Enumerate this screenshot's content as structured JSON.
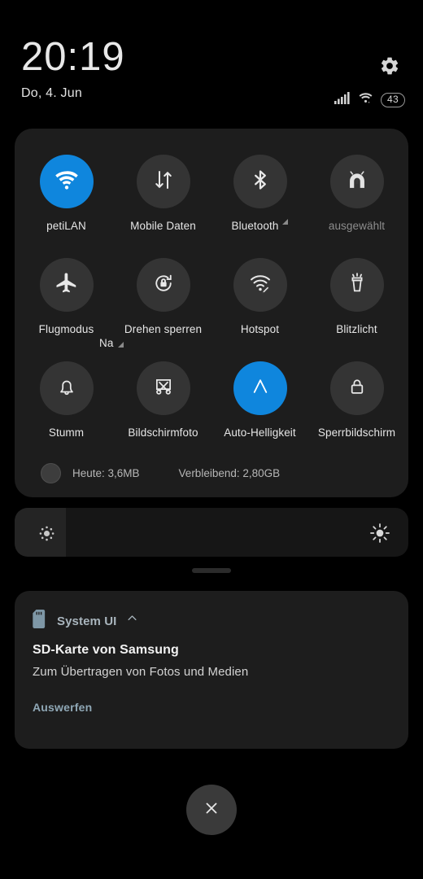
{
  "statusbar": {
    "time": "20:19",
    "date": "Do, 4. Jun",
    "battery_level": "43",
    "settings_icon": "gear-icon",
    "signal_icon": "signal-bars-icon",
    "wifi_icon": "wifi-status-icon"
  },
  "quick_settings": {
    "tiles": [
      {
        "id": "wifi",
        "label": "petiLAN",
        "sublabel": "Na",
        "icon": "wifi-icon",
        "active": true,
        "has_expand_arrow": true,
        "dim": false
      },
      {
        "id": "mobile-data",
        "label": "Mobile Daten",
        "sublabel": "",
        "icon": "data-transfer-icon",
        "active": false,
        "has_expand_arrow": false,
        "dim": false
      },
      {
        "id": "bluetooth",
        "label": "Bluetooth",
        "sublabel": "",
        "icon": "bluetooth-icon",
        "active": false,
        "has_expand_arrow": true,
        "dim": false
      },
      {
        "id": "vpn",
        "label": "ausgewählt",
        "sublabel": "",
        "icon": "vpn-tunnel-icon",
        "active": false,
        "has_expand_arrow": false,
        "dim": true
      },
      {
        "id": "airplane-mode",
        "label": "Flugmodus",
        "sublabel": "",
        "icon": "airplane-icon",
        "active": false,
        "has_expand_arrow": false,
        "dim": false
      },
      {
        "id": "rotation-lock",
        "label": "Drehen sperren",
        "sublabel": "",
        "icon": "rotation-lock-icon",
        "active": false,
        "has_expand_arrow": false,
        "dim": false
      },
      {
        "id": "hotspot",
        "label": "Hotspot",
        "sublabel": "",
        "icon": "hotspot-icon",
        "active": false,
        "has_expand_arrow": false,
        "dim": false
      },
      {
        "id": "flashlight",
        "label": "Blitzlicht",
        "sublabel": "",
        "icon": "flashlight-icon",
        "active": false,
        "has_expand_arrow": false,
        "dim": false
      },
      {
        "id": "mute",
        "label": "Stumm",
        "sublabel": "",
        "icon": "bell-icon",
        "active": false,
        "has_expand_arrow": false,
        "dim": false
      },
      {
        "id": "screenshot",
        "label": "Bildschirmfoto",
        "sublabel": "",
        "icon": "screenshot-icon",
        "active": false,
        "has_expand_arrow": false,
        "dim": false
      },
      {
        "id": "auto-brightness",
        "label": "Auto-Helligkeit",
        "sublabel": "",
        "icon": "auto-brightness-icon",
        "active": true,
        "has_expand_arrow": false,
        "dim": false
      },
      {
        "id": "lock-screen",
        "label": "Sperrbildschirm",
        "sublabel": "",
        "icon": "padlock-icon",
        "active": false,
        "has_expand_arrow": false,
        "dim": false
      }
    ],
    "data_usage": {
      "today": "Heute: 3,6MB",
      "remaining": "Verbleibend: 2,80GB"
    },
    "accent_color": "#0f86dd",
    "panel_color": "#1d1d1d"
  },
  "brightness": {
    "value_percent": 13,
    "low_icon": "brightness-low-icon",
    "high_icon": "brightness-high-icon"
  },
  "notification": {
    "app_name": "System UI",
    "app_icon": "sd-card-icon",
    "collapse_icon": "chevron-up-icon",
    "title": "SD-Karte von Samsung",
    "body": "Zum Übertragen von Fotos und Medien",
    "action_label": "Auswerfen",
    "action_color": "#8fa7b5"
  },
  "footer": {
    "close_icon": "close-icon"
  }
}
